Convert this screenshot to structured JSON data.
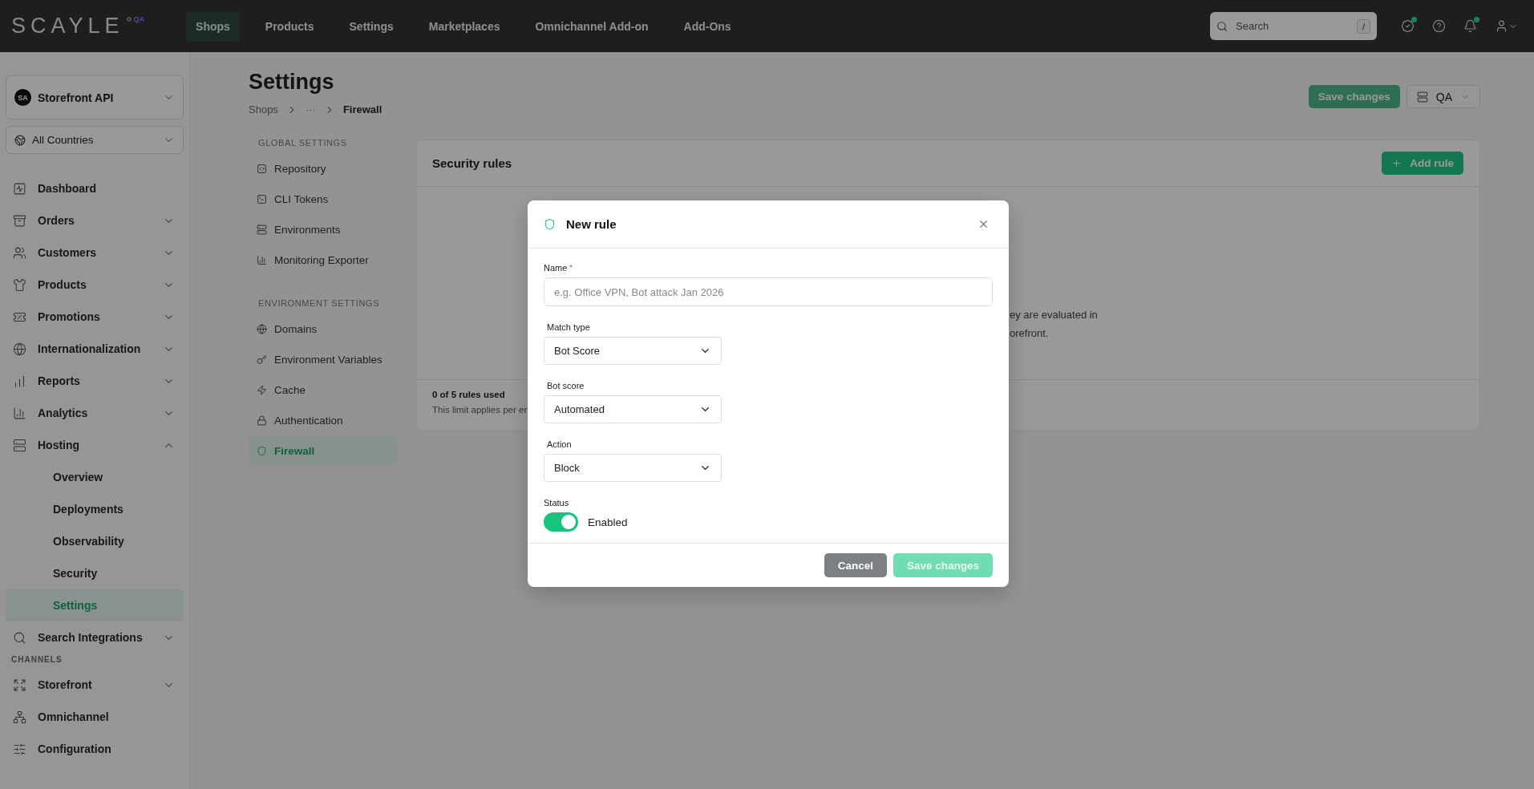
{
  "topbar": {
    "logo": "SCAYLE",
    "logo_badge": "QA",
    "nav": [
      {
        "label": "Shops",
        "selected": true
      },
      {
        "label": "Products",
        "selected": false
      },
      {
        "label": "Settings",
        "selected": false
      },
      {
        "label": "Marketplaces",
        "selected": false
      },
      {
        "label": "Omnichannel Add-on",
        "selected": false
      },
      {
        "label": "Add-Ons",
        "selected": false
      }
    ],
    "search": {
      "placeholder": "Search",
      "shortcut": "/"
    },
    "icons": [
      {
        "badge": true
      },
      {
        "badge": false
      },
      {
        "badge": true
      },
      {
        "badge": false
      }
    ]
  },
  "sidebar": {
    "shop_selector": {
      "avatar": "SA",
      "label": "Storefront API"
    },
    "country_selector": {
      "label": "All Countries"
    },
    "sections": [
      {
        "items": [
          {
            "label": "Dashboard",
            "kind": "link"
          },
          {
            "label": "Orders",
            "kind": "group",
            "expanded": false
          },
          {
            "label": "Customers",
            "kind": "group",
            "expanded": false
          },
          {
            "label": "Products",
            "kind": "group",
            "expanded": false
          },
          {
            "label": "Promotions",
            "kind": "group",
            "expanded": false
          },
          {
            "label": "Internationalization",
            "kind": "group",
            "expanded": false
          },
          {
            "label": "Reports",
            "kind": "group",
            "expanded": false
          },
          {
            "label": "Analytics",
            "kind": "group",
            "expanded": false
          },
          {
            "label": "Hosting",
            "kind": "group",
            "expanded": true,
            "children": [
              {
                "label": "Overview",
                "selected": false
              },
              {
                "label": "Deployments",
                "selected": false
              },
              {
                "label": "Observability",
                "selected": false
              },
              {
                "label": "Security",
                "selected": false
              },
              {
                "label": "Settings",
                "selected": true
              }
            ]
          },
          {
            "label": "Search Integrations",
            "kind": "group",
            "expanded": false
          }
        ]
      },
      {
        "title": "CHANNELS",
        "items": [
          {
            "label": "Storefront",
            "kind": "group",
            "expanded": false
          },
          {
            "label": "Omnichannel",
            "kind": "link"
          },
          {
            "label": "Configuration",
            "kind": "link"
          }
        ]
      }
    ]
  },
  "header": {
    "title": "Settings",
    "breadcrumb": [
      "Shops",
      "···",
      "Firewall"
    ],
    "save_button": {
      "label": "Save changes",
      "disabled": true
    },
    "environment": {
      "label": "QA"
    }
  },
  "settings_nav": [
    {
      "title": "GLOBAL SETTINGS",
      "items": [
        {
          "label": "Repository",
          "selected": false
        },
        {
          "label": "CLI Tokens",
          "selected": false
        },
        {
          "label": "Environments",
          "selected": false
        },
        {
          "label": "Monitoring Exporter",
          "selected": false
        }
      ]
    },
    {
      "title": "ENVIRONMENT SETTINGS",
      "items": [
        {
          "label": "Domains",
          "selected": false
        },
        {
          "label": "Environment Variables",
          "selected": false
        },
        {
          "label": "Cache",
          "selected": false
        },
        {
          "label": "Authentication",
          "selected": false
        },
        {
          "label": "Firewall",
          "selected": true
        }
      ]
    }
  ],
  "card": {
    "title": "Security rules",
    "add_button": "Add rule",
    "body_lines": [
      "ey are evaluated in",
      "orefront."
    ],
    "usage": "0 of 5 rules used",
    "note": "This limit applies per en"
  },
  "modal": {
    "title": "New rule",
    "name": {
      "label": "Name",
      "required_mark": "*",
      "placeholder": "e.g. Office VPN, Bot attack Jan 2026"
    },
    "selects": [
      {
        "label": "Match type",
        "value": "Bot Score"
      },
      {
        "label": "Bot score",
        "value": "Automated"
      },
      {
        "label": "Action",
        "value": "Block"
      }
    ],
    "status": {
      "label": "Status",
      "on": true,
      "text": "Enabled"
    },
    "cancel": "Cancel",
    "save": {
      "label": "Save changes",
      "disabled": true
    }
  }
}
